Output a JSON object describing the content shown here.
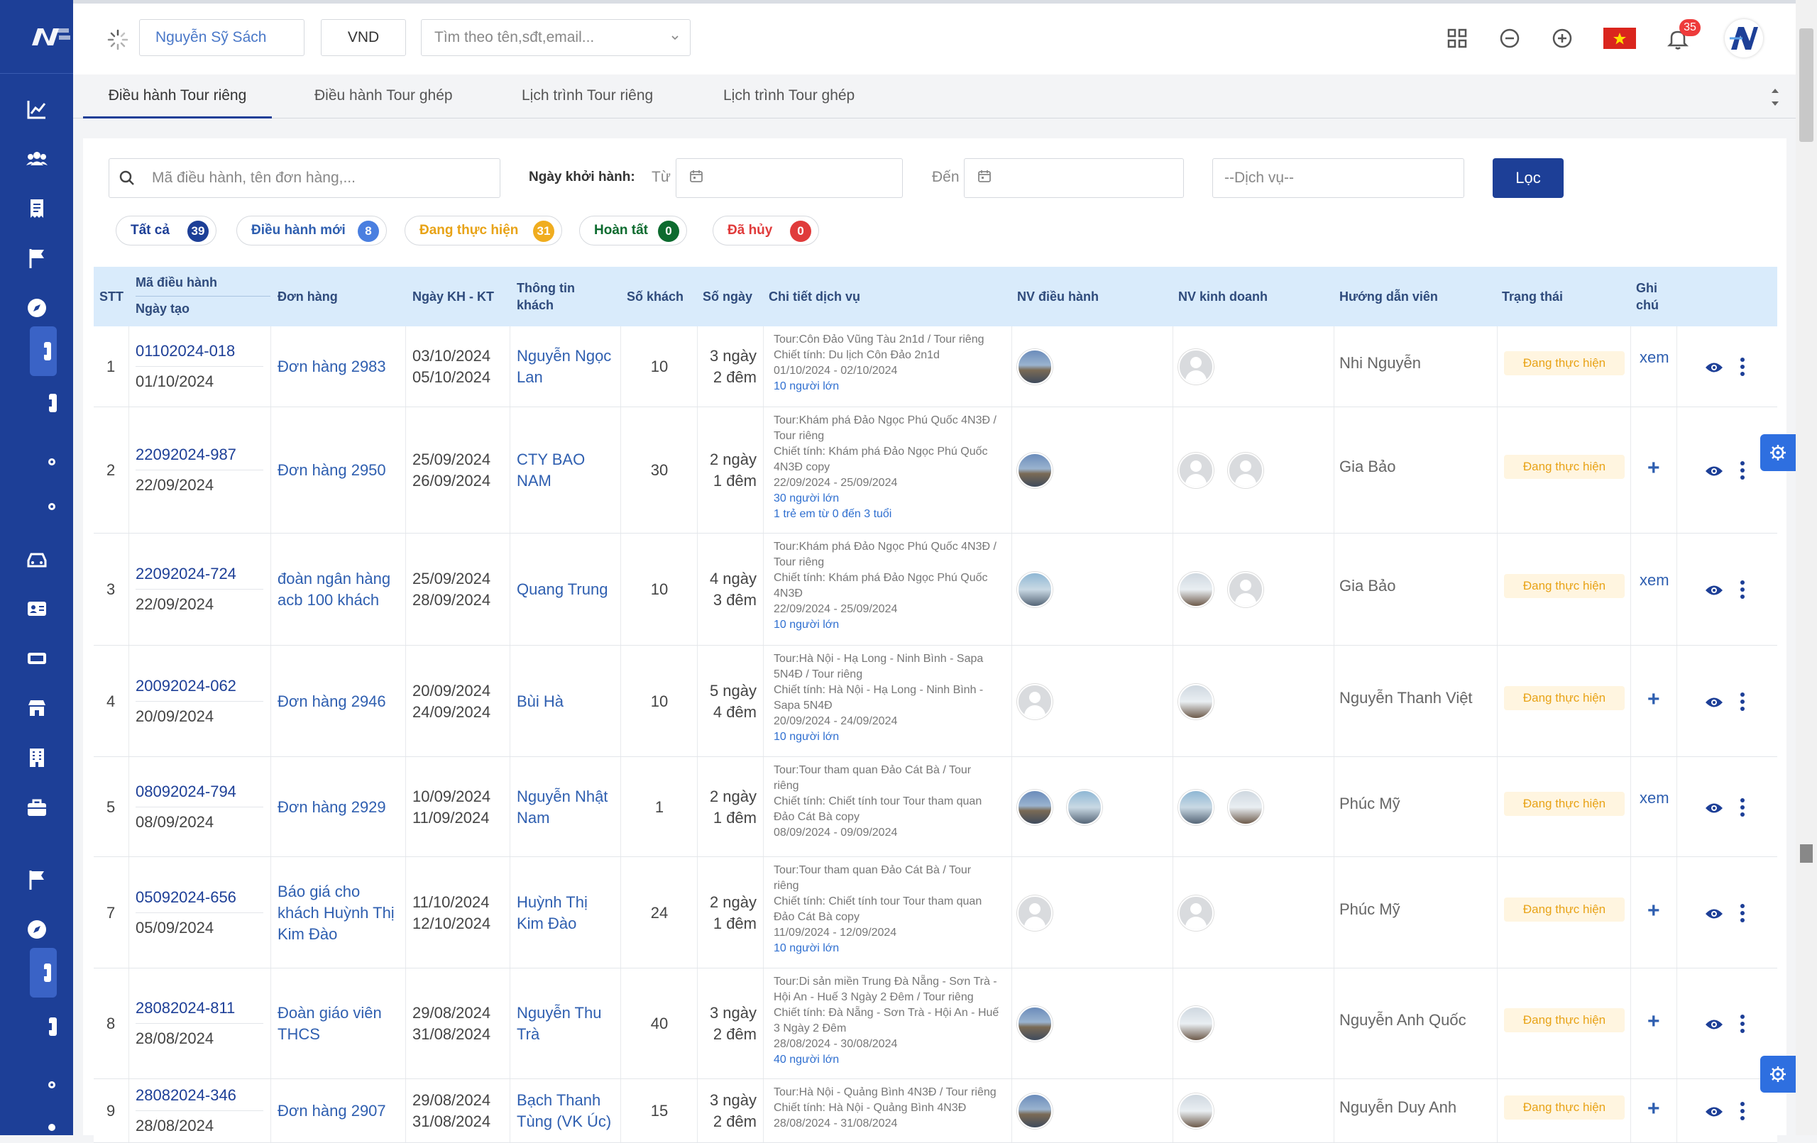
{
  "header": {
    "user_name": "Nguyễn Sỹ Sách",
    "currency": "VND",
    "search_placeholder": "Tìm theo tên,sđt,email...",
    "notification_count": "35"
  },
  "tabs": [
    "Điều hành Tour riêng",
    "Điều hành Tour ghép",
    "Lịch trình Tour riêng",
    "Lịch trình Tour ghép"
  ],
  "filters": {
    "search_placeholder": "Mã điều hành, tên đơn hàng,...",
    "date_label": "Ngày khởi hành:",
    "from_label": "Từ",
    "to_label": "Đến",
    "service_placeholder": "--Dịch vụ--",
    "filter_button": "Lọc"
  },
  "status_pills": [
    {
      "label": "Tất cả",
      "count": "39",
      "color": "#1d3f97",
      "text_color": "#1d3f97"
    },
    {
      "label": "Điều hành mới",
      "count": "8",
      "color": "#4a7fe0",
      "text_color": "#2f5fb0"
    },
    {
      "label": "Đang thực hiện",
      "count": "31",
      "color": "#f0ad1f",
      "text_color": "#e8a317"
    },
    {
      "label": "Hoàn tất",
      "count": "0",
      "color": "#0d6b2f",
      "text_color": "#0d6b2f"
    },
    {
      "label": "Đã hủy",
      "count": "0",
      "color": "#e03b3b",
      "text_color": "#e03b3b"
    }
  ],
  "columns": {
    "stt": "STT",
    "code": "Mã điều hành",
    "created": "Ngày tạo",
    "order": "Đơn hàng",
    "dates": "Ngày KH - KT",
    "customer1": "Thông tin",
    "customer2": "khách",
    "guests": "Số khách",
    "days": "Số ngày",
    "detail": "Chi tiết dịch vụ",
    "operator": "NV điều hành",
    "sales": "NV kinh doanh",
    "guide": "Hướng dẫn viên",
    "status": "Trạng thái",
    "note1": "Ghi",
    "note2": "chú"
  },
  "rows": [
    {
      "stt": "1",
      "code": "01102024-018",
      "created": "01/10/2024",
      "order": [
        "Đơn hàng 2983"
      ],
      "start": "03/10/2024",
      "end": "05/10/2024",
      "customer": [
        "Nguyễn Ngọc",
        "Lan"
      ],
      "guests": "10",
      "days": "3 ngày",
      "nights": "2 đêm",
      "detail": [
        "Tour:Côn Đảo Vũng Tàu 2n1d / Tour riêng",
        "Chiết tính: Du lịch Côn Đảo 2n1d",
        "01/10/2024 - 02/10/2024"
      ],
      "pax": [
        "10 người lớn"
      ],
      "operators": [
        "photo"
      ],
      "sales": [
        "blank"
      ],
      "guide": "Nhi Nguyễn",
      "status": "Đang thực hiện",
      "note": "xem"
    },
    {
      "stt": "2",
      "code": "22092024-987",
      "created": "22/09/2024",
      "order": [
        "Đơn hàng 2950"
      ],
      "start": "25/09/2024",
      "end": "26/09/2024",
      "customer": [
        "CTY BAO",
        "NAM"
      ],
      "guests": "30",
      "days": "2 ngày",
      "nights": "1 đêm",
      "detail": [
        "Tour:Khám phá Đảo Ngọc Phú Quốc 4N3Đ /",
        "Tour riêng",
        "Chiết tính: Khám phá Đảo Ngọc Phú Quốc",
        "4N3Đ copy",
        "22/09/2024 - 25/09/2024"
      ],
      "pax": [
        "30 người lớn",
        "1 trẻ em từ 0 đến 3 tuổi"
      ],
      "operators": [
        "photo"
      ],
      "sales": [
        "blank",
        "blank"
      ],
      "guide": "Gia Bảo",
      "status": "Đang thực hiện",
      "note": "+"
    },
    {
      "stt": "3",
      "code": "22092024-724",
      "created": "22/09/2024",
      "order": [
        "đoàn ngân hàng",
        "acb 100 khách"
      ],
      "start": "25/09/2024",
      "end": "28/09/2024",
      "customer": [
        "Quang Trung"
      ],
      "guests": "10",
      "days": "4 ngày",
      "nights": "3 đêm",
      "detail": [
        "Tour:Khám phá Đảo Ngọc Phú Quốc 4N3Đ /",
        "Tour riêng",
        "Chiết tính: Khám phá Đảo Ngọc Phú Quốc",
        "4N3Đ",
        "22/09/2024 - 25/09/2024"
      ],
      "pax": [
        "10 người lớn"
      ],
      "operators": [
        "photo2"
      ],
      "sales": [
        "person",
        "blank"
      ],
      "guide": "Gia Bảo",
      "status": "Đang thực hiện",
      "note": "xem"
    },
    {
      "stt": "4",
      "code": "20092024-062",
      "created": "20/09/2024",
      "order": [
        "Đơn hàng 2946"
      ],
      "start": "20/09/2024",
      "end": "24/09/2024",
      "customer": [
        "Bùi Hà"
      ],
      "guests": "10",
      "days": "5 ngày",
      "nights": "4 đêm",
      "detail": [
        "Tour:Hà Nội - Hạ Long - Ninh Bình - Sapa",
        "5N4Đ / Tour riêng",
        "Chiết tính: Hà Nội - Hạ Long - Ninh Bình -",
        "Sapa 5N4Đ",
        "20/09/2024 - 24/09/2024"
      ],
      "pax": [
        "10 người lớn"
      ],
      "operators": [
        "blank"
      ],
      "sales": [
        "person"
      ],
      "guide": "Nguyễn Thanh Việt",
      "status": "Đang thực hiện",
      "note": "+"
    },
    {
      "stt": "5",
      "code": "08092024-794",
      "created": "08/09/2024",
      "order": [
        "Đơn hàng 2929"
      ],
      "start": "10/09/2024",
      "end": "11/09/2024",
      "customer": [
        "Nguyễn Nhật",
        "Nam"
      ],
      "guests": "1",
      "days": "2 ngày",
      "nights": "1 đêm",
      "detail": [
        "Tour:Tour tham quan Đảo Cát Bà / Tour",
        "riêng",
        "Chiết tính: Chiết tính tour Tour tham quan",
        "Đảo Cát Bà copy",
        "08/09/2024 - 09/09/2024"
      ],
      "pax": [],
      "operators": [
        "photo",
        "photo2"
      ],
      "sales": [
        "photo2",
        "person"
      ],
      "guide": "Phúc Mỹ",
      "status": "Đang thực hiện",
      "note": "xem"
    },
    {
      "stt": "7",
      "code": "05092024-656",
      "created": "05/09/2024",
      "order": [
        "Báo giá cho",
        "khách Huỳnh Thị",
        "Kim Đào"
      ],
      "start": "11/10/2024",
      "end": "12/10/2024",
      "customer": [
        "Huỳnh Thị",
        "Kim Đào"
      ],
      "guests": "24",
      "days": "2 ngày",
      "nights": "1 đêm",
      "detail": [
        "Tour:Tour tham quan Đảo Cát Bà / Tour",
        "riêng",
        "Chiết tính: Chiết tính tour Tour tham quan",
        "Đảo Cát Bà copy",
        "11/09/2024 - 12/09/2024"
      ],
      "pax": [
        "10 người lớn"
      ],
      "operators": [
        "blank"
      ],
      "sales": [
        "blank"
      ],
      "guide": "Phúc Mỹ",
      "status": "Đang thực hiện",
      "note": "+"
    },
    {
      "stt": "8",
      "code": "28082024-811",
      "created": "28/08/2024",
      "order": [
        "Đoàn giáo viên",
        "THCS"
      ],
      "start": "29/08/2024",
      "end": "31/08/2024",
      "customer": [
        "Nguyễn Thu",
        "Trà"
      ],
      "guests": "40",
      "days": "3 ngày",
      "nights": "2 đêm",
      "detail": [
        "Tour:Di sản miền Trung Đà Nẵng - Sơn Trà -",
        "Hội An - Huế 3 Ngày 2 Đêm / Tour riêng",
        "Chiết tính: Đà Nẵng - Sơn Trà - Hội An - Huế",
        "3 Ngày 2 Đêm",
        "28/08/2024 - 30/08/2024"
      ],
      "pax": [
        "40 người lớn"
      ],
      "operators": [
        "photo"
      ],
      "sales": [
        "person"
      ],
      "guide": "Nguyễn Anh Quốc",
      "status": "Đang thực hiện",
      "note": "+"
    },
    {
      "stt": "9",
      "code": "28082024-346",
      "created": "28/08/2024",
      "order": [
        "Đơn hàng 2907"
      ],
      "start": "29/08/2024",
      "end": "31/08/2024",
      "customer": [
        "Bạch Thanh",
        "Tùng (VK Úc)"
      ],
      "guests": "15",
      "days": "3 ngày",
      "nights": "2 đêm",
      "detail": [
        "Tour:Hà Nội - Quảng Bình 4N3Đ / Tour riêng",
        "Chiết tính: Hà Nội - Quảng Bình 4N3Đ",
        "28/08/2024 - 31/08/2024"
      ],
      "pax": [],
      "operators": [
        "photo"
      ],
      "sales": [
        "person"
      ],
      "guide": "Nguyễn Duy Anh",
      "status": "Đang thực hiện",
      "note": "+"
    }
  ]
}
